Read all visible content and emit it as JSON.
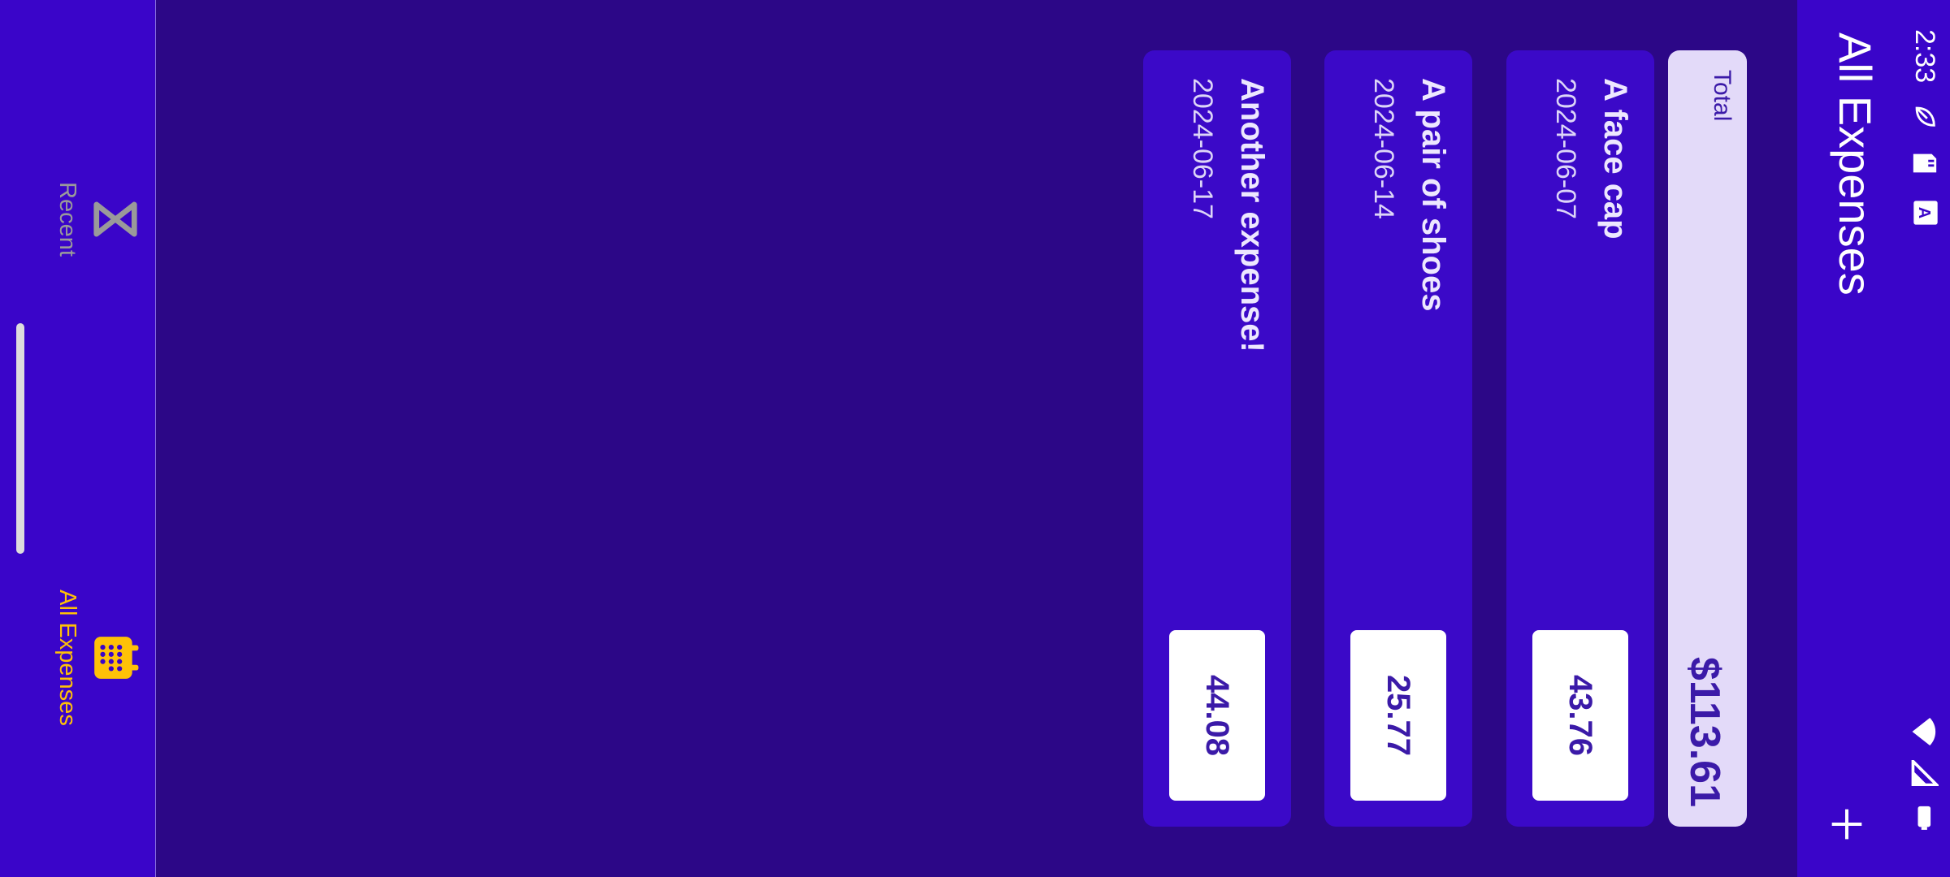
{
  "status_bar": {
    "time": "2:33",
    "icons": [
      "notification-leaf-icon",
      "sd-card-icon",
      "text-a-icon",
      "wifi-icon",
      "signal-icon",
      "battery-icon"
    ]
  },
  "app_bar": {
    "title": "All Expenses",
    "add_icon": "plus-icon"
  },
  "summary": {
    "label": "Total",
    "value": "$113.61"
  },
  "expenses": [
    {
      "title": "A face cap",
      "date": "2024-06-07",
      "amount": "43.76"
    },
    {
      "title": "A pair of shoes",
      "date": "2024-06-14",
      "amount": "25.77"
    },
    {
      "title": "Another expense!",
      "date": "2024-06-17",
      "amount": "44.08"
    }
  ],
  "bottom_nav": {
    "items": [
      {
        "label": "Recent",
        "icon": "hourglass-icon",
        "active": false
      },
      {
        "label": "All Expenses",
        "icon": "calendar-icon",
        "active": true
      }
    ]
  },
  "colors": {
    "background": "#2c0787",
    "bar": "#3a05c9",
    "card": "#3b09c8",
    "total_card": "#e3daf9",
    "active_nav": "#ffc107",
    "inactive_nav": "#9a9a9a"
  }
}
